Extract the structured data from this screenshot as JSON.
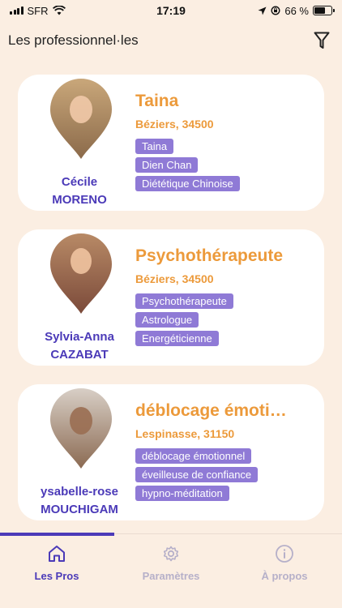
{
  "status_bar": {
    "carrier": "SFR",
    "time": "17:19",
    "battery_text": "66 %",
    "battery_level": 0.66
  },
  "header": {
    "title": "Les professionnel·les",
    "filter_icon": "filter-icon"
  },
  "professionals": [
    {
      "first_name": "Cécile",
      "last_name": "MORENO",
      "title": "Taina",
      "city": "Béziers, 34500",
      "tags": [
        "Taina",
        "Dien Chan",
        "Diététique Chinoise"
      ],
      "photo_colors": [
        "#c9a77a",
        "#8b6a4a"
      ]
    },
    {
      "first_name": "Sylvia-Anna",
      "last_name": "CAZABAT",
      "title": "Psychothérapeute",
      "city": "Béziers, 34500",
      "tags": [
        "Psychothérapeute",
        "Astrologue",
        "Energéticienne"
      ],
      "photo_colors": [
        "#b88a66",
        "#7b4a3a"
      ]
    },
    {
      "first_name": "ysabelle-rose",
      "last_name": "MOUCHIGAM",
      "title": "déblocage émoti…",
      "city": "Lespinasse, 31150",
      "tags": [
        "déblocage émotionnel",
        "éveilleuse de confiance",
        "hypno-méditation"
      ],
      "photo_colors": [
        "#d8cfc6",
        "#8b6a52"
      ]
    }
  ],
  "tabbar": {
    "tabs": [
      {
        "label": "Les Pros",
        "icon": "home-icon",
        "active": true
      },
      {
        "label": "Paramètres",
        "icon": "gear-icon",
        "active": false
      },
      {
        "label": "À propos",
        "icon": "info-icon",
        "active": false
      }
    ]
  },
  "colors": {
    "background": "#fbeee2",
    "accent_purple": "#4b3ab8",
    "accent_orange": "#ec9a3b",
    "tag_purple": "#8f7ad6"
  }
}
